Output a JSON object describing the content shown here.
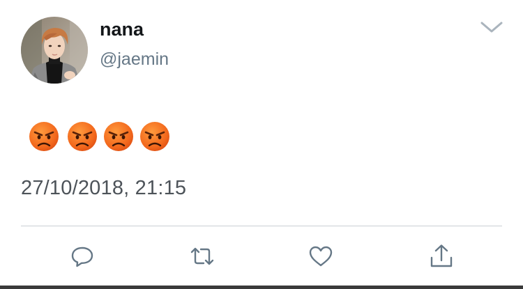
{
  "tweet": {
    "author": {
      "display_name": "nana",
      "handle": "@jaemin"
    },
    "content": {
      "emojis": [
        "angry-face",
        "angry-face",
        "angry-face",
        "angry-face"
      ]
    },
    "timestamp": "27/10/2018, 21:15",
    "actions": [
      "reply-icon",
      "retweet-icon",
      "like-icon",
      "share-icon"
    ],
    "colors": {
      "name": "#14171a",
      "handle": "#657786",
      "timestamp": "#4d5359",
      "icon": "#657786",
      "divider": "#c9cfd4",
      "emoji_face": "#f06a1e"
    }
  }
}
